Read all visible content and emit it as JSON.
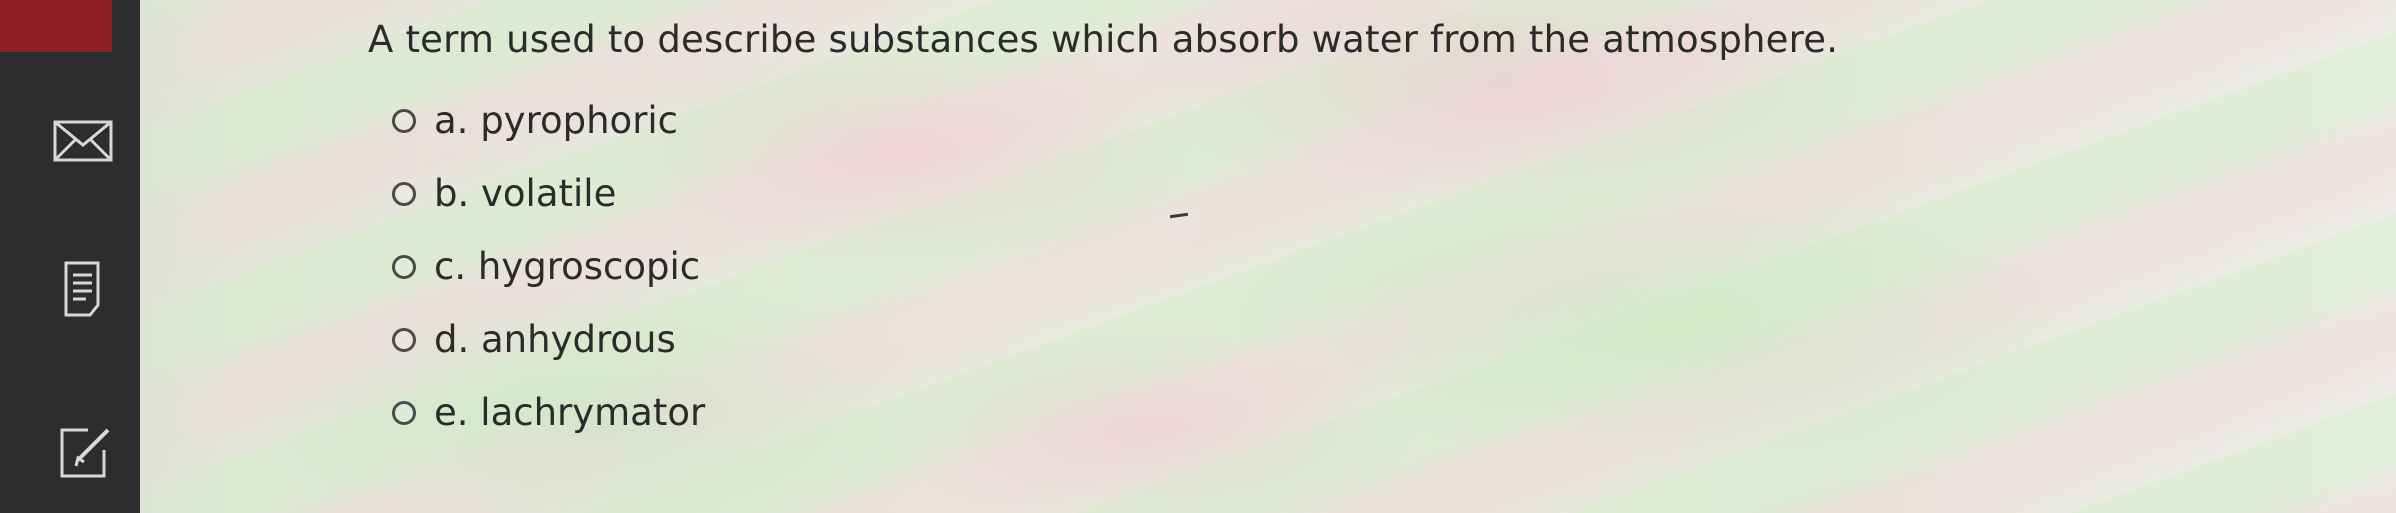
{
  "question": {
    "text": "A term used to describe substances which absorb water from the atmosphere."
  },
  "options": [
    {
      "label": "a. pyrophoric",
      "selected": false
    },
    {
      "label": "b. volatile",
      "selected": false
    },
    {
      "label": "c. hygroscopic",
      "selected": false
    },
    {
      "label": "d. anhydrous",
      "selected": false
    },
    {
      "label": "e. lachrymator",
      "selected": false
    }
  ],
  "sidebar": {
    "icons": [
      "mail-icon",
      "notes-icon",
      "edit-icon"
    ],
    "accent_color": "#8b1f22",
    "background_color": "#2b2d2e"
  }
}
